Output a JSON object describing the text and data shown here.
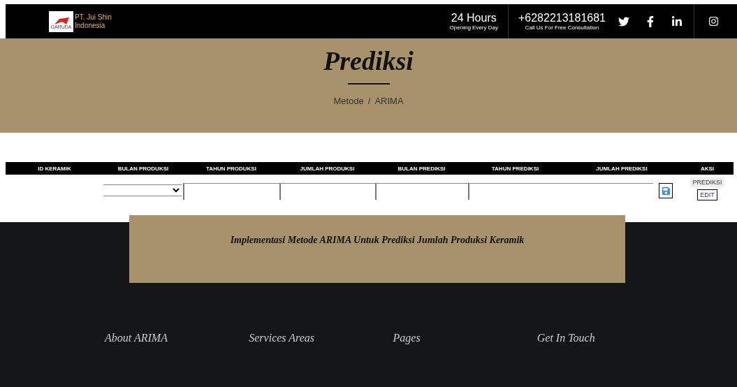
{
  "header": {
    "logo_text": "GARUDA",
    "company_name": [
      "PT. Jui Shin",
      "Indonesia"
    ],
    "hours": {
      "title": "24 Hours",
      "subtitle": "Opening Every Day"
    },
    "phone": {
      "title": "+6282213181681",
      "subtitle": "Call Us For Free Consultation"
    }
  },
  "banner": {
    "title": "Prediksi",
    "breadcrumb": [
      {
        "label": "Metode"
      },
      {
        "label": "ARIMA"
      }
    ],
    "separator": "/"
  },
  "table": {
    "columns": [
      "ID KERAMIK",
      "BULAN PRODUKSI",
      "TAHUN PRODUKSI",
      "JUMLAH PRODUKSI",
      "BULAN PREDIKSI",
      "TAHUN PREDIKSI",
      "JUMLAH PREDIKSI",
      "AKSI"
    ],
    "actions": [
      {
        "label": "PREDIKSI",
        "kind": "predict"
      },
      {
        "label": "EDIT",
        "kind": "edit"
      }
    ]
  },
  "callout": {
    "text": "Implementasi Metode ARIMA Untuk Prediksi Jumlah Produksi Keramik"
  },
  "footer": {
    "headings": [
      "About ARIMA",
      "Services Areas",
      "Pages",
      "Get In Touch"
    ]
  }
}
